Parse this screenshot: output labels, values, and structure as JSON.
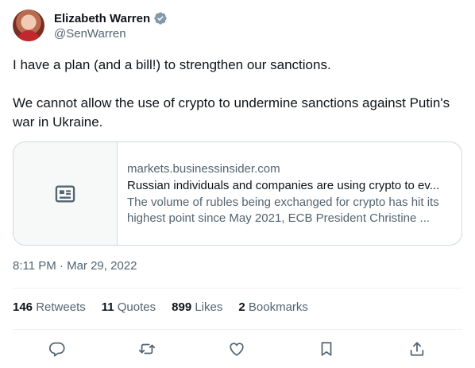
{
  "author": {
    "name": "Elizabeth Warren",
    "handle": "@SenWarren",
    "verified": true
  },
  "tweet": {
    "line1": "I have a plan (and a bill!) to strengthen our sanctions.",
    "line2": "We cannot allow the use of crypto to undermine sanctions against Putin's war in Ukraine."
  },
  "card": {
    "domain": "markets.businessinsider.com",
    "title": "Russian individuals and companies are using crypto to ev...",
    "description": "The volume of rubles being exchanged for crypto has hit its highest point since May 2021, ECB President Christine ...",
    "icon": "article-icon"
  },
  "timestamp": "8:11 PM · Mar 29, 2022",
  "stats": {
    "retweets_count": "146",
    "retweets_label": "Retweets",
    "quotes_count": "11",
    "quotes_label": "Quotes",
    "likes_count": "899",
    "likes_label": "Likes",
    "bookmarks_count": "2",
    "bookmarks_label": "Bookmarks"
  },
  "actions": [
    "reply-icon",
    "retweet-icon",
    "like-icon",
    "bookmark-icon",
    "share-icon"
  ],
  "colors": {
    "text": "#0f1419",
    "secondary": "#536471",
    "border": "#cfd9de",
    "divider": "#eff3f4",
    "verified_badge": "#829aab"
  }
}
